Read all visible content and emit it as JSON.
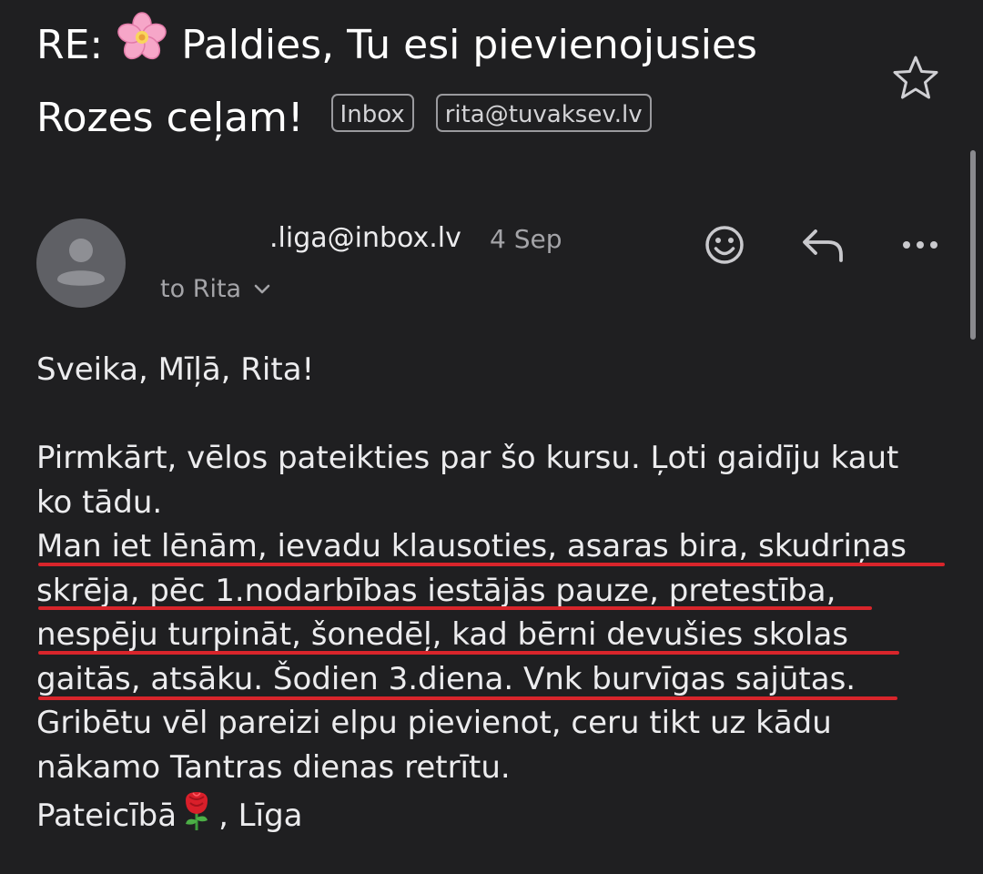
{
  "email": {
    "subject_prefix": "RE:",
    "subject_text": "Paldies, Tu esi pievienojusies Rozes ceļam!",
    "labels": [
      "Inbox",
      "rita@tuvaksev.lv"
    ],
    "sender": ".liga@inbox.lv",
    "date": "4 Sep",
    "recipient": "to Rita",
    "body": {
      "greeting": "Sveika, Mīļā, Rita!",
      "line1": "Pirmkārt, vēlos pateikties par šo kursu. Ļoti gaidīju kaut",
      "line2": "ko tādu.",
      "line3": "Man iet lēnām, ievadu klausoties, asaras bira, skudriņas",
      "line4": "skrēja, pēc 1.nodarbības iestājās pauze, pretestība,",
      "line5": "nespēju turpināt, šonedēļ, kad bērni devušies skolas",
      "line6": "gaitās, atsāku. Šodien 3.diena. Vnk burvīgas sajūtas.",
      "line7": "Gribētu vēl pareizi elpu pievienot, ceru tikt uz kādu",
      "line8": "nākamo Tantras dienas retrītu.",
      "signoff_before": "Pateicībā",
      "signoff_after": ", Līga"
    }
  },
  "icons": {
    "subject_emoji": "cherry-blossom-icon",
    "star": "star-icon",
    "avatar": "default-avatar-icon",
    "emoji_react": "emoji-react-icon",
    "reply": "reply-icon",
    "more": "more-horizontal-icon",
    "chevron": "chevron-down-icon",
    "rose": "rose-icon"
  },
  "colors": {
    "background": "#1f1f21",
    "underline": "#d8252b",
    "muted_text": "#a4a4a8"
  }
}
